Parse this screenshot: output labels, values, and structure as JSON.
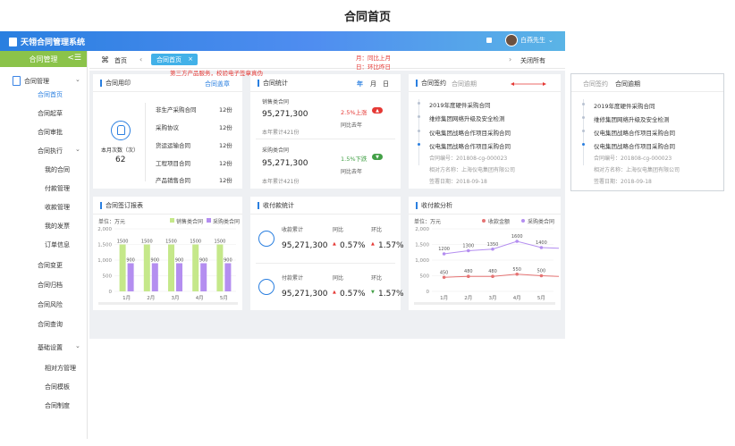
{
  "page_title": "合同首页",
  "app": {
    "brand": "天翎合同管理系统",
    "user_name": "白燕先生"
  },
  "sidebar": {
    "header": "合同管理",
    "collapse_icon": "<☰",
    "group1": "合同管理",
    "items_top": [
      "合同首页",
      "合同起草",
      "合同审批"
    ],
    "exec_group": "合同执行",
    "exec_items": [
      "我的合同",
      "付款管理",
      "收款管理",
      "我的发票",
      "订单信息"
    ],
    "items_mid": [
      "合同变更",
      "合同归档",
      "合同风险",
      "合同查询"
    ],
    "base_group": "基础设置",
    "base_items": [
      "相对方管理",
      "合同模板",
      "合同制度"
    ]
  },
  "tabs": {
    "home": "首页",
    "active": "合同首页",
    "close_all": "关闭所有"
  },
  "annotations": {
    "third_party": "第三方产品服务，校验电子签章真伪",
    "mom": "月：同比上月",
    "day": "日：环比昨日"
  },
  "cards": {
    "usage": {
      "title": "合同用印",
      "link": "合同盖章",
      "count_label": "本月次数（次）",
      "count": "62",
      "rows": [
        {
          "label": "非生产采购合同",
          "value": "12份"
        },
        {
          "label": "采购协议",
          "value": "12份"
        },
        {
          "label": "货运运输合同",
          "value": "12份"
        },
        {
          "label": "工程项目合同",
          "value": "12份"
        },
        {
          "label": "产品销售合同",
          "value": "12份"
        }
      ]
    },
    "stats": {
      "title": "合同统计",
      "periods": [
        "年",
        "月",
        "日"
      ],
      "sales": {
        "label": "销售类合同",
        "amount": "95,271,300",
        "change": "2.5%上涨",
        "compare": "同比去年",
        "total": "本年累计421份"
      },
      "purchase": {
        "label": "采购类合同",
        "amount": "95,271,300",
        "change": "1.5%下跌",
        "compare": "同比去年",
        "total": "本年累计421份"
      }
    },
    "sign": {
      "tab_active": "合同签约",
      "tab_other": "合同逾期",
      "items": [
        "2019年度硬件采购合同",
        "维修集团网络升级及安全检测",
        "仪电集团战略合作项目采购合同",
        "仪电集团战略合作项目采购合同"
      ]
    },
    "overdue": {
      "tab_other": "合同签约",
      "tab_active": "合同逾期",
      "items": [
        "2019年度硬件采购合同",
        "维修集团网络升级及安全检测",
        "仪电集团战略合作项目采购合同",
        "仪电集团战略合作项目采购合同"
      ],
      "detail": {
        "code": "合同编号：201808-cg-000023",
        "party": "相对方名称：上海仪电集团有限公司",
        "date": "签署日期：2018-09-18"
      }
    },
    "orders": {
      "title": "合同签订报表",
      "unit": "单位：万元",
      "legend": [
        "销售类合同",
        "采购类合同"
      ]
    },
    "payments": {
      "title": "收付款统计",
      "receive": {
        "label": "收款累计",
        "amount": "95,271,300",
        "yoy_label": "同比",
        "yoy": "0.57%",
        "mom_label": "环比",
        "mom": "1.57%"
      },
      "pay": {
        "label": "付款累计",
        "amount": "95,271,300",
        "yoy_label": "同比",
        "yoy": "0.57%",
        "mom_label": "环比",
        "mom": "1.57%"
      }
    },
    "analysis": {
      "title": "收付款分析",
      "unit": "单位：万元",
      "legend": [
        "收款金额",
        "采购类合同"
      ]
    }
  },
  "chart_data": [
    {
      "type": "bar",
      "title": "合同签订报表",
      "categories": [
        "1月",
        "2月",
        "3月",
        "4月",
        "5月"
      ],
      "series": [
        {
          "name": "销售类合同",
          "values": [
            1500,
            1500,
            1500,
            1500,
            1500
          ],
          "color": "#c5e88a"
        },
        {
          "name": "采购类合同",
          "values": [
            900,
            900,
            900,
            900,
            900
          ],
          "color": "#b48ef0"
        }
      ],
      "yticks": [
        0,
        500,
        1000,
        1500,
        2000
      ],
      "ylim": [
        0,
        2000
      ]
    },
    {
      "type": "line",
      "title": "收付款分析",
      "categories": [
        "1月",
        "2月",
        "3月",
        "4月",
        "5月"
      ],
      "series": [
        {
          "name": "收款金额",
          "values": [
            450,
            480,
            480,
            550,
            500
          ],
          "color": "#e57373"
        },
        {
          "name": "采购类合同",
          "values": [
            1200,
            1300,
            1350,
            1600,
            1400
          ],
          "color": "#b48ef0"
        }
      ],
      "yticks": [
        0,
        500,
        1000,
        1500,
        2000
      ],
      "ylim": [
        0,
        2000
      ]
    }
  ]
}
